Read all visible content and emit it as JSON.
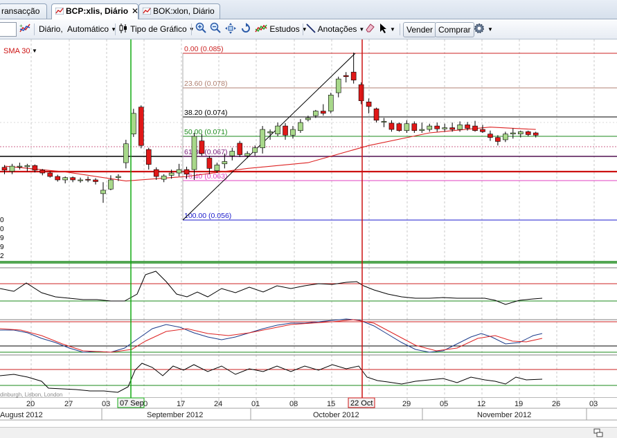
{
  "tabs": [
    {
      "label": "ransacção",
      "active": false,
      "closable": false,
      "icon": "chart-icon"
    },
    {
      "label": "BCP:xlis, Diário",
      "active": true,
      "closable": true,
      "icon": "chart-icon"
    },
    {
      "label": "BOK:xlon, Diário",
      "active": false,
      "closable": false,
      "icon": "chart-icon"
    }
  ],
  "toolbar": {
    "interval": "Diário,",
    "scale": "Automático",
    "chart_type": "Tipo de Gráfico",
    "studies": "Estudos",
    "annotations": "Anotações",
    "sell": "Vender",
    "buy": "Comprar"
  },
  "indicator_label": "SMA 30",
  "fib_levels": [
    {
      "label": "0.00 (0.085)",
      "price": 0.085,
      "color": "#cc2222"
    },
    {
      "label": "23.60 (0.078)",
      "price": 0.078,
      "color": "#b08070"
    },
    {
      "label": "38.20 (0.074)",
      "price": 0.074,
      "color": "#000000"
    },
    {
      "label": "50.00 (0.071)",
      "price": 0.071,
      "color": "#1a8a1a"
    },
    {
      "label": "61.80 (0.067)",
      "price": 0.067,
      "color": "#7a1a7a"
    },
    {
      "label": "76.40 (0.063)",
      "price": 0.063,
      "color": "#e040c0"
    },
    {
      "label": "100.00 (0.056)",
      "price": 0.056,
      "color": "#1a1acc"
    }
  ],
  "left_axis_fragments": [
    "0",
    "0",
    "9",
    "9",
    "2"
  ],
  "watermark": "dinburgh, Lisbon, London",
  "x_axis": {
    "days": [
      "20",
      "27",
      "03",
      "10",
      "17",
      "24",
      "01",
      "08",
      "15",
      "22",
      "29",
      "05",
      "12",
      "19",
      "26",
      "03"
    ],
    "months": [
      "August 2012",
      "September 2012",
      "October 2012",
      "November 2012"
    ],
    "cursor_labels": [
      "07 Sep",
      "22 Oct"
    ]
  },
  "colors": {
    "up_candle": "#a8d88a",
    "down_candle": "#e01818",
    "sma": "#dd2222",
    "cursor_green": "#11aa11",
    "cursor_red": "#cc1111"
  },
  "chart_data": {
    "type": "candlestick",
    "symbol": "BCP:xlis",
    "interval": "Diário",
    "price_range": [
      0.052,
      0.087
    ],
    "candles": [
      {
        "open": 0.0652,
        "high": 0.0656,
        "low": 0.064,
        "close": 0.0647
      },
      {
        "open": 0.0645,
        "high": 0.0658,
        "low": 0.064,
        "close": 0.0654
      },
      {
        "open": 0.0654,
        "high": 0.066,
        "low": 0.0648,
        "close": 0.0654
      },
      {
        "open": 0.0653,
        "high": 0.0658,
        "low": 0.0645,
        "close": 0.0655
      },
      {
        "open": 0.0655,
        "high": 0.0657,
        "low": 0.0643,
        "close": 0.0647
      },
      {
        "open": 0.0647,
        "high": 0.0649,
        "low": 0.0638,
        "close": 0.0642
      },
      {
        "open": 0.0642,
        "high": 0.0645,
        "low": 0.0634,
        "close": 0.0636
      },
      {
        "open": 0.0636,
        "high": 0.0639,
        "low": 0.0627,
        "close": 0.063
      },
      {
        "open": 0.063,
        "high": 0.0636,
        "low": 0.0624,
        "close": 0.0634
      },
      {
        "open": 0.0634,
        "high": 0.0636,
        "low": 0.0626,
        "close": 0.063
      },
      {
        "open": 0.063,
        "high": 0.0634,
        "low": 0.0625,
        "close": 0.063
      },
      {
        "open": 0.0631,
        "high": 0.0636,
        "low": 0.0626,
        "close": 0.063
      },
      {
        "open": 0.063,
        "high": 0.0633,
        "low": 0.0622,
        "close": 0.0627
      },
      {
        "open": 0.0606,
        "high": 0.0626,
        "low": 0.059,
        "close": 0.0612
      },
      {
        "open": 0.0614,
        "high": 0.0638,
        "low": 0.0612,
        "close": 0.063
      },
      {
        "open": 0.0634,
        "high": 0.064,
        "low": 0.0628,
        "close": 0.0636
      },
      {
        "open": 0.066,
        "high": 0.07,
        "low": 0.065,
        "close": 0.0693
      },
      {
        "open": 0.071,
        "high": 0.0754,
        "low": 0.0705,
        "close": 0.0746
      },
      {
        "open": 0.0757,
        "high": 0.076,
        "low": 0.0685,
        "close": 0.069
      },
      {
        "open": 0.0683,
        "high": 0.0686,
        "low": 0.0648,
        "close": 0.0657
      },
      {
        "open": 0.0648,
        "high": 0.0652,
        "low": 0.063,
        "close": 0.0636
      },
      {
        "open": 0.0631,
        "high": 0.064,
        "low": 0.0626,
        "close": 0.0637
      },
      {
        "open": 0.0638,
        "high": 0.0648,
        "low": 0.0632,
        "close": 0.0642
      },
      {
        "open": 0.0642,
        "high": 0.0658,
        "low": 0.0636,
        "close": 0.0648
      },
      {
        "open": 0.0648,
        "high": 0.0653,
        "low": 0.0632,
        "close": 0.064
      },
      {
        "open": 0.0648,
        "high": 0.0712,
        "low": 0.063,
        "close": 0.0706
      },
      {
        "open": 0.0698,
        "high": 0.071,
        "low": 0.0672,
        "close": 0.0676
      },
      {
        "open": 0.0668,
        "high": 0.0672,
        "low": 0.064,
        "close": 0.065
      },
      {
        "open": 0.0646,
        "high": 0.066,
        "low": 0.0642,
        "close": 0.0656
      },
      {
        "open": 0.0658,
        "high": 0.0676,
        "low": 0.065,
        "close": 0.0662
      },
      {
        "open": 0.0672,
        "high": 0.0686,
        "low": 0.0664,
        "close": 0.068
      },
      {
        "open": 0.0694,
        "high": 0.0698,
        "low": 0.067,
        "close": 0.0674
      },
      {
        "open": 0.0672,
        "high": 0.068,
        "low": 0.0668,
        "close": 0.0676
      },
      {
        "open": 0.0678,
        "high": 0.069,
        "low": 0.0672,
        "close": 0.0686
      },
      {
        "open": 0.0686,
        "high": 0.0724,
        "low": 0.0676,
        "close": 0.0718
      },
      {
        "open": 0.0712,
        "high": 0.0718,
        "low": 0.07,
        "close": 0.0714
      },
      {
        "open": 0.071,
        "high": 0.073,
        "low": 0.0706,
        "close": 0.0724
      },
      {
        "open": 0.0724,
        "high": 0.0729,
        "low": 0.07,
        "close": 0.0708
      },
      {
        "open": 0.0708,
        "high": 0.0724,
        "low": 0.0702,
        "close": 0.0718
      },
      {
        "open": 0.0716,
        "high": 0.0736,
        "low": 0.0712,
        "close": 0.073
      },
      {
        "open": 0.0735,
        "high": 0.0742,
        "low": 0.0732,
        "close": 0.0738
      },
      {
        "open": 0.0742,
        "high": 0.0752,
        "low": 0.0738,
        "close": 0.075
      },
      {
        "open": 0.075,
        "high": 0.0762,
        "low": 0.0742,
        "close": 0.0746
      },
      {
        "open": 0.075,
        "high": 0.0782,
        "low": 0.0746,
        "close": 0.0778
      },
      {
        "open": 0.0782,
        "high": 0.081,
        "low": 0.0774,
        "close": 0.0806
      },
      {
        "open": 0.0812,
        "high": 0.0818,
        "low": 0.08,
        "close": 0.081
      },
      {
        "open": 0.0818,
        "high": 0.0852,
        "low": 0.0798,
        "close": 0.0804
      },
      {
        "open": 0.0796,
        "high": 0.08,
        "low": 0.0762,
        "close": 0.0768
      },
      {
        "open": 0.0766,
        "high": 0.0772,
        "low": 0.0746,
        "close": 0.0758
      },
      {
        "open": 0.0754,
        "high": 0.0756,
        "low": 0.073,
        "close": 0.0734
      },
      {
        "open": 0.0731,
        "high": 0.0738,
        "low": 0.0722,
        "close": 0.0732
      },
      {
        "open": 0.0729,
        "high": 0.0734,
        "low": 0.0714,
        "close": 0.0718
      },
      {
        "open": 0.0728,
        "high": 0.073,
        "low": 0.0714,
        "close": 0.0716
      },
      {
        "open": 0.0716,
        "high": 0.0734,
        "low": 0.0712,
        "close": 0.0728
      },
      {
        "open": 0.0728,
        "high": 0.0732,
        "low": 0.0712,
        "close": 0.0716
      },
      {
        "open": 0.0716,
        "high": 0.073,
        "low": 0.0712,
        "close": 0.0718
      },
      {
        "open": 0.0718,
        "high": 0.0728,
        "low": 0.0714,
        "close": 0.0724
      },
      {
        "open": 0.0724,
        "high": 0.073,
        "low": 0.0714,
        "close": 0.0719
      },
      {
        "open": 0.0719,
        "high": 0.0728,
        "low": 0.0714,
        "close": 0.0721
      },
      {
        "open": 0.0721,
        "high": 0.073,
        "low": 0.0714,
        "close": 0.0718
      },
      {
        "open": 0.0718,
        "high": 0.0732,
        "low": 0.0714,
        "close": 0.0726
      },
      {
        "open": 0.0726,
        "high": 0.0731,
        "low": 0.0716,
        "close": 0.072
      },
      {
        "open": 0.0724,
        "high": 0.0733,
        "low": 0.0714,
        "close": 0.0716
      },
      {
        "open": 0.0718,
        "high": 0.0726,
        "low": 0.0712,
        "close": 0.0714
      },
      {
        "open": 0.071,
        "high": 0.0716,
        "low": 0.0698,
        "close": 0.0704
      },
      {
        "open": 0.0704,
        "high": 0.0708,
        "low": 0.069,
        "close": 0.0697
      },
      {
        "open": 0.07,
        "high": 0.0714,
        "low": 0.0696,
        "close": 0.071
      },
      {
        "open": 0.071,
        "high": 0.072,
        "low": 0.0702,
        "close": 0.0712
      },
      {
        "open": 0.071,
        "high": 0.0716,
        "low": 0.0704,
        "close": 0.0714
      },
      {
        "open": 0.0714,
        "high": 0.0716,
        "low": 0.0706,
        "close": 0.0709
      },
      {
        "open": 0.0712,
        "high": 0.0714,
        "low": 0.0704,
        "close": 0.0708
      }
    ],
    "sma30": [
      [
        0,
        0.0654
      ],
      [
        8,
        0.0644
      ],
      [
        16,
        0.0628
      ],
      [
        24,
        0.0636
      ],
      [
        32,
        0.065
      ],
      [
        40,
        0.066
      ],
      [
        48,
        0.069
      ],
      [
        56,
        0.0712
      ],
      [
        64,
        0.0722
      ],
      [
        70,
        0.0718
      ]
    ]
  }
}
